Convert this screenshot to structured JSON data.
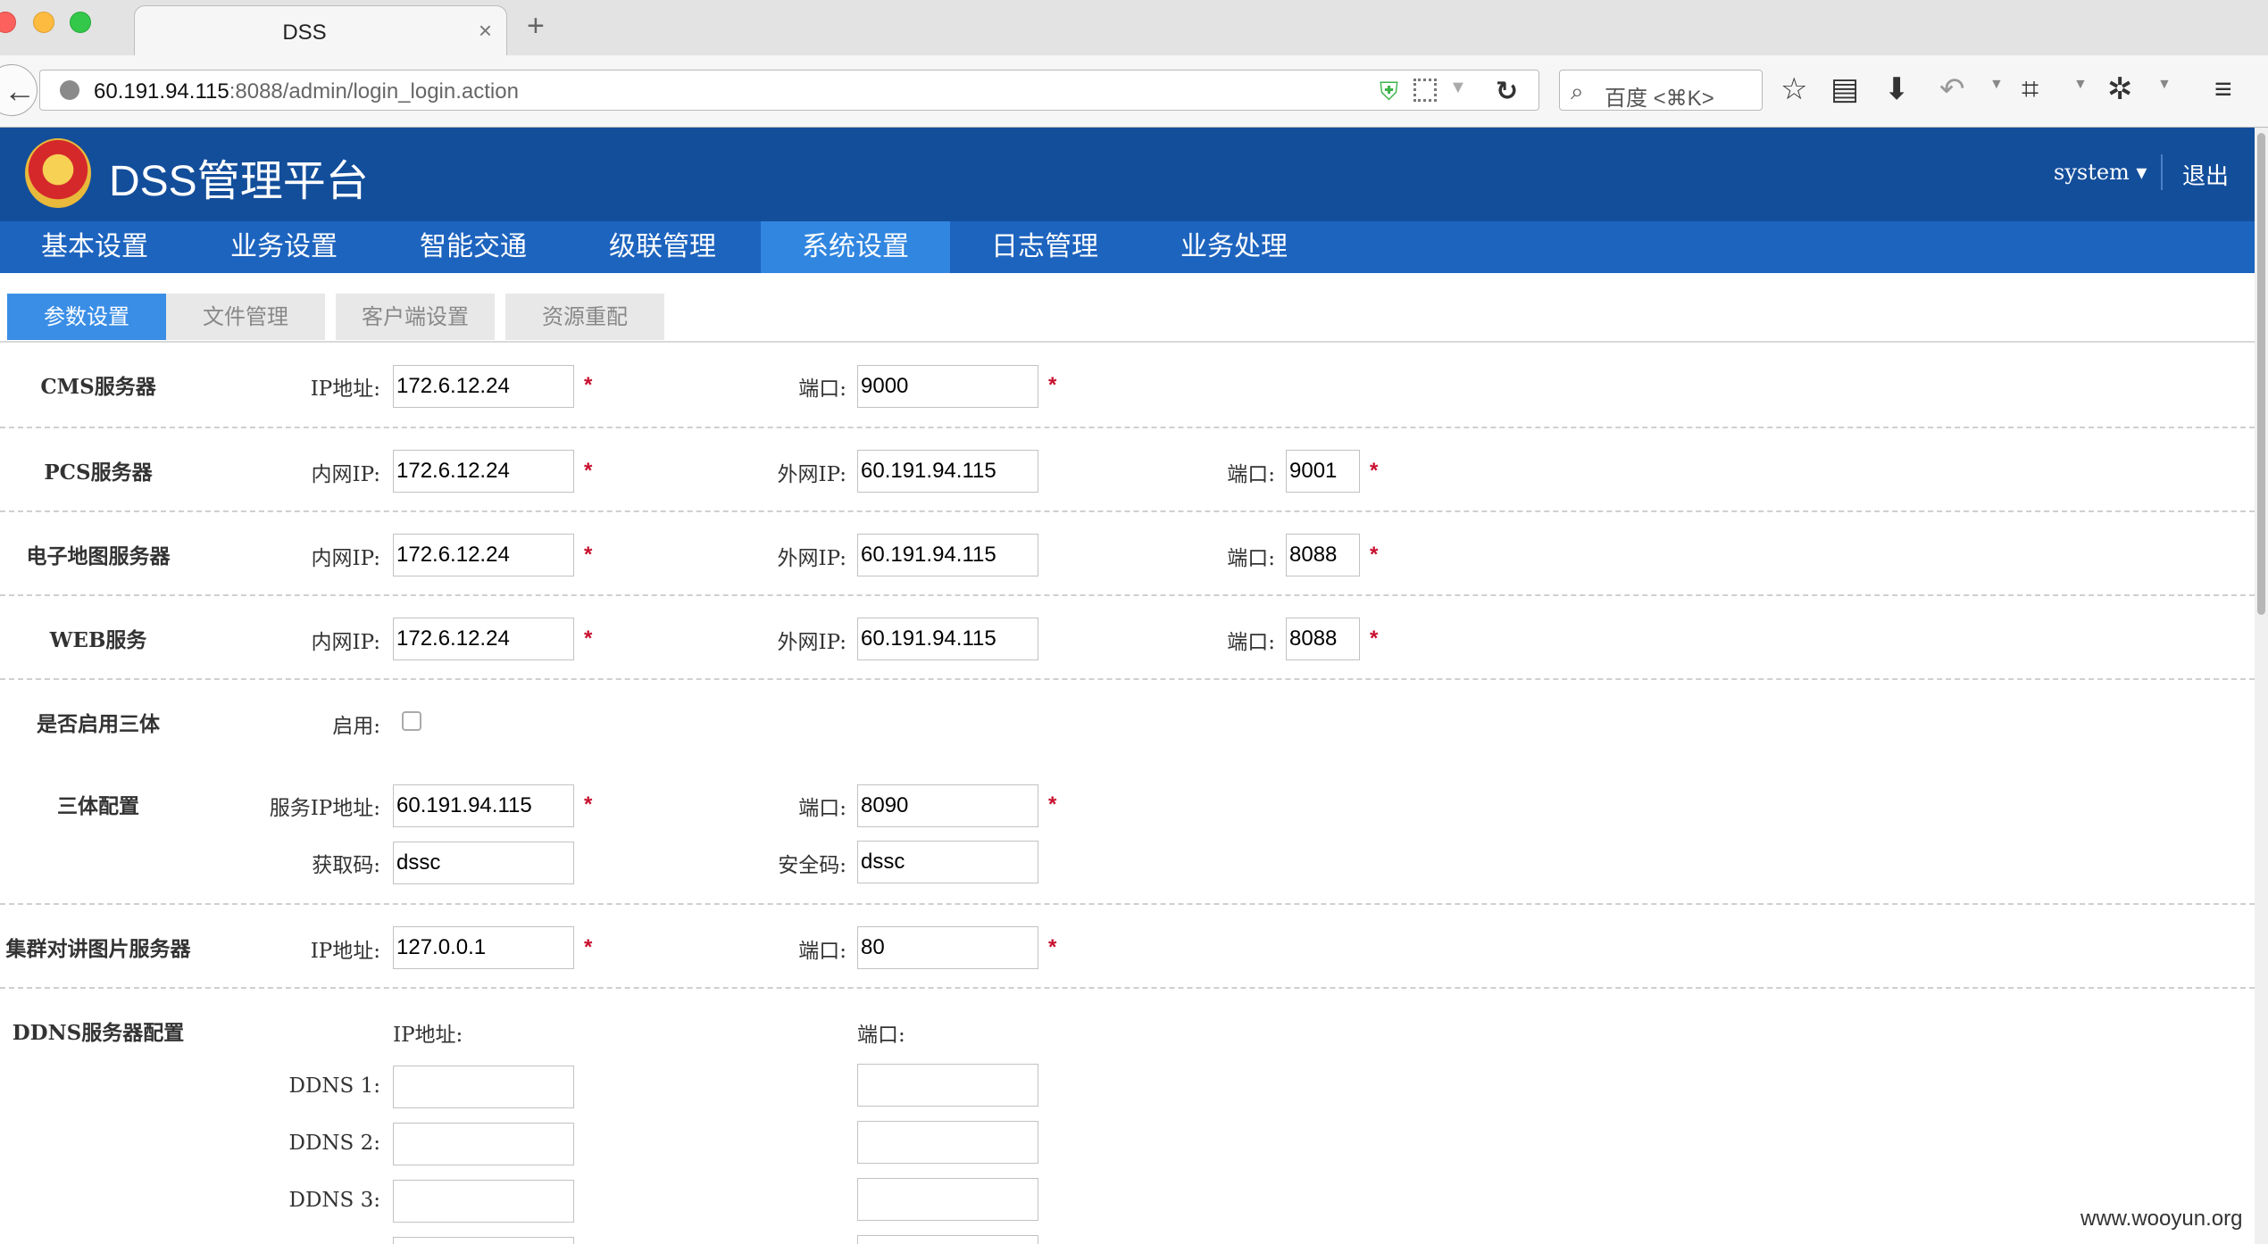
{
  "browser": {
    "tab_title": "DSS",
    "tab_close": "×",
    "new_tab": "+",
    "url_host": "60.191.94.115",
    "url_rest": ":8088/admin/login_login.action",
    "search_placeholder": "百度 <⌘K>"
  },
  "header": {
    "title": "DSS管理平台",
    "user": "system ▾",
    "logout": "退出"
  },
  "menu": [
    {
      "label": "基本设置"
    },
    {
      "label": "业务设置"
    },
    {
      "label": "智能交通"
    },
    {
      "label": "级联管理"
    },
    {
      "label": "系统设置"
    },
    {
      "label": "日志管理"
    },
    {
      "label": "业务处理"
    }
  ],
  "subtabs": [
    {
      "label": "参数设置"
    },
    {
      "label": "文件管理"
    },
    {
      "label": "客户端设置"
    },
    {
      "label": "资源重配"
    }
  ],
  "labels": {
    "ip": "IP地址:",
    "port": "端口:",
    "inner_ip": "内网IP:",
    "outer_ip": "外网IP:",
    "enable": "启用:",
    "service_ip": "服务IP地址:",
    "fetch_code": "获取码:",
    "security_code": "安全码:",
    "ip_header": "IP地址:",
    "port_header": "端口:",
    "required": "*"
  },
  "sections": {
    "cms": {
      "title": "CMS服务器",
      "ip": "172.6.12.24",
      "port": "9000"
    },
    "pcs": {
      "title": "PCS服务器",
      "inner_ip": "172.6.12.24",
      "outer_ip": "60.191.94.115",
      "port": "9001"
    },
    "emap": {
      "title": "电子地图服务器",
      "inner_ip": "172.6.12.24",
      "outer_ip": "60.191.94.115",
      "port": "8088"
    },
    "web": {
      "title": "WEB服务",
      "inner_ip": "172.6.12.24",
      "outer_ip": "60.191.94.115",
      "port": "8088"
    },
    "three_body": {
      "title": "是否启用三体"
    },
    "three_config": {
      "title": "三体配置",
      "service_ip": "60.191.94.115",
      "port": "8090",
      "fetch_code": "dssc",
      "security_code": "dssc"
    },
    "cluster": {
      "title": "集群对讲图片服务器",
      "ip": "127.0.0.1",
      "port": "80"
    },
    "ddns": {
      "title": "DDNS服务器配置",
      "rows": [
        {
          "label": "DDNS 1:",
          "ip": "",
          "port": ""
        },
        {
          "label": "DDNS 2:",
          "ip": "",
          "port": ""
        },
        {
          "label": "DDNS 3:",
          "ip": "",
          "port": ""
        }
      ]
    }
  },
  "watermark": "www.wooyun.org"
}
